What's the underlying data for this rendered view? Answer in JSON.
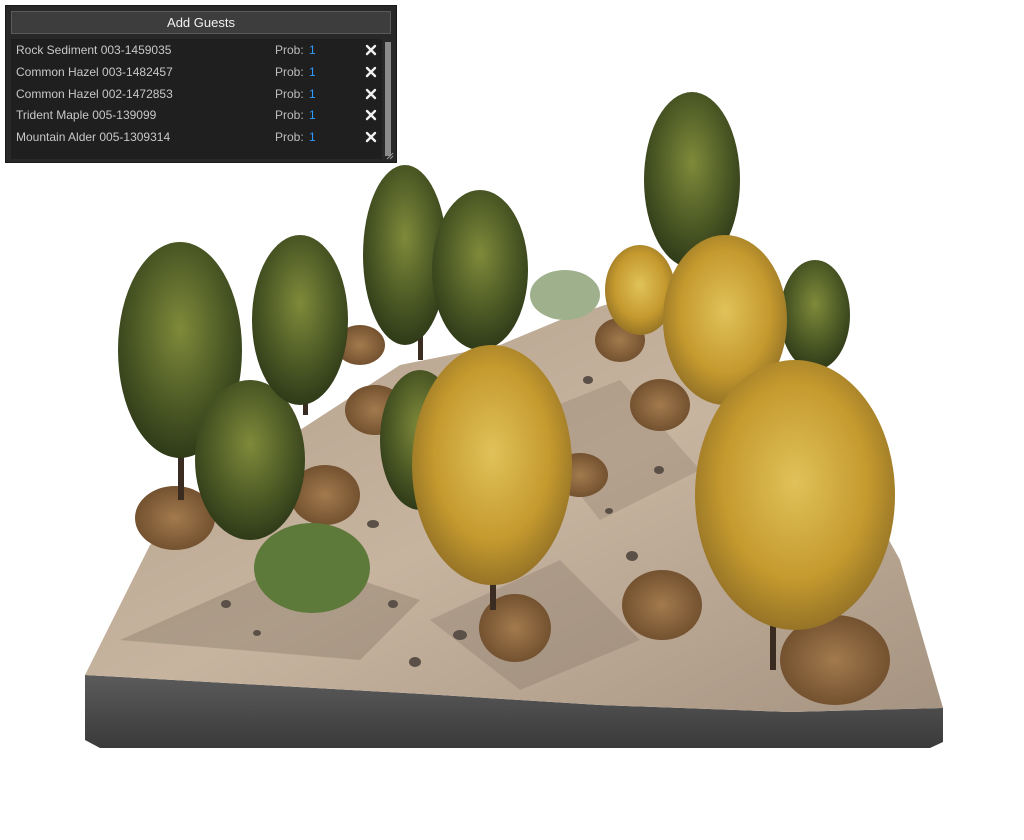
{
  "panel": {
    "title": "Add Guests",
    "prob_label": "Prob:",
    "guests": [
      {
        "name": "Rock Sediment 003-1459035",
        "prob": "1"
      },
      {
        "name": "Common Hazel 003-1482457",
        "prob": "1"
      },
      {
        "name": "Common Hazel 002-1472853",
        "prob": "1"
      },
      {
        "name": "Trident Maple 005-139099",
        "prob": "1"
      },
      {
        "name": "Mountain Alder 005-1309314",
        "prob": "1"
      }
    ]
  },
  "icons": {
    "remove": "close-icon",
    "resize": "resize-grip-icon"
  },
  "colors": {
    "prob_value": "#2e9bff",
    "panel_bg": "#282828"
  }
}
